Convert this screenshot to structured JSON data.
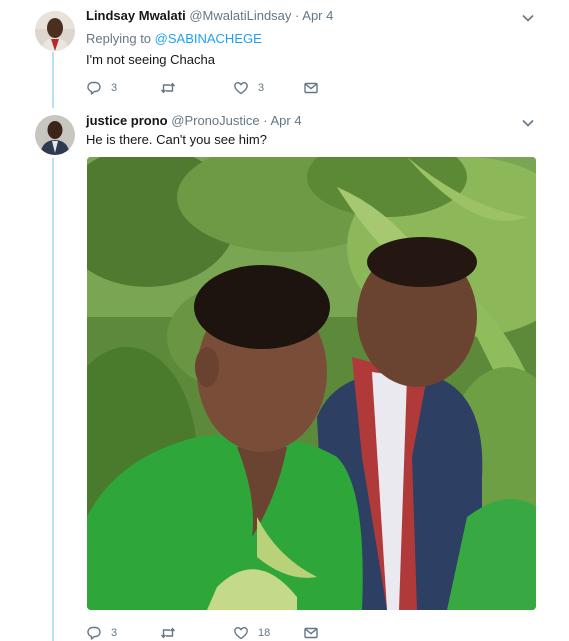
{
  "tweets": [
    {
      "name": "Lindsay Mwalati",
      "handle": "@MwalatiLindsay",
      "separator": "·",
      "date": "Apr 4",
      "replying_prefix": "Replying to ",
      "replying_mention": "@SABINACHEGE",
      "text": "I'm not seeing Chacha",
      "replies": "3",
      "retweets": "",
      "likes": "3"
    },
    {
      "name": "justice prono",
      "handle": "@PronoJustice",
      "separator": "·",
      "date": "Apr 4",
      "text": "He is there. Can't you see him?",
      "replies": "3",
      "retweets": "",
      "likes": "18"
    }
  ],
  "icons": [
    "reply-icon",
    "retweet-icon",
    "like-icon",
    "message-icon",
    "chevron-down-icon"
  ],
  "colors": {
    "accent": "#1da1f2",
    "thread_line": "#b8e0f5",
    "muted": "#657786",
    "text": "#14171a"
  }
}
